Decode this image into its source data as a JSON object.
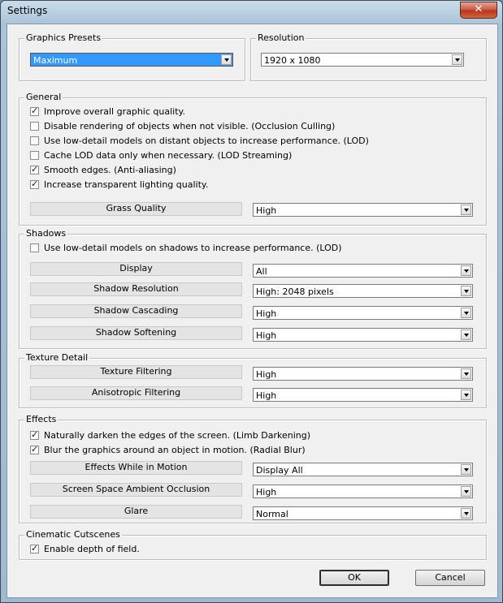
{
  "window": {
    "title": "Settings",
    "close_glyph": "✕"
  },
  "graphics_presets": {
    "legend": "Graphics Presets",
    "value": "Maximum"
  },
  "resolution": {
    "legend": "Resolution",
    "value": "1920 x 1080"
  },
  "general": {
    "legend": "General",
    "checks": [
      {
        "label": "Improve overall graphic quality.",
        "checked": true
      },
      {
        "label": "Disable rendering of objects when not visible. (Occlusion Culling)",
        "checked": false
      },
      {
        "label": "Use low-detail models on distant objects to increase performance. (LOD)",
        "checked": false
      },
      {
        "label": "Cache LOD data only when necessary. (LOD Streaming)",
        "checked": false
      },
      {
        "label": "Smooth edges. (Anti-aliasing)",
        "checked": true
      },
      {
        "label": "Increase transparent lighting quality.",
        "checked": true
      }
    ],
    "settings": [
      {
        "label": "Grass Quality",
        "value": "High"
      }
    ]
  },
  "shadows": {
    "legend": "Shadows",
    "checks": [
      {
        "label": "Use low-detail models on shadows to increase performance. (LOD)",
        "checked": false
      }
    ],
    "settings": [
      {
        "label": "Display",
        "value": "All"
      },
      {
        "label": "Shadow Resolution",
        "value": "High: 2048 pixels"
      },
      {
        "label": "Shadow Cascading",
        "value": "High"
      },
      {
        "label": "Shadow Softening",
        "value": "High"
      }
    ]
  },
  "texture": {
    "legend": "Texture Detail",
    "settings": [
      {
        "label": "Texture Filtering",
        "value": "High"
      },
      {
        "label": "Anisotropic Filtering",
        "value": "High"
      }
    ]
  },
  "effects": {
    "legend": "Effects",
    "checks": [
      {
        "label": "Naturally darken the edges of the screen. (Limb Darkening)",
        "checked": true
      },
      {
        "label": "Blur the graphics around an object in motion. (Radial Blur)",
        "checked": true
      }
    ],
    "settings": [
      {
        "label": "Effects While in Motion",
        "value": "Display All"
      },
      {
        "label": "Screen Space Ambient Occlusion",
        "value": "High"
      },
      {
        "label": "Glare",
        "value": "Normal"
      }
    ]
  },
  "cutscenes": {
    "legend": "Cinematic Cutscenes",
    "checks": [
      {
        "label": "Enable depth of field.",
        "checked": true
      }
    ]
  },
  "buttons": {
    "ok": "OK",
    "cancel": "Cancel"
  }
}
